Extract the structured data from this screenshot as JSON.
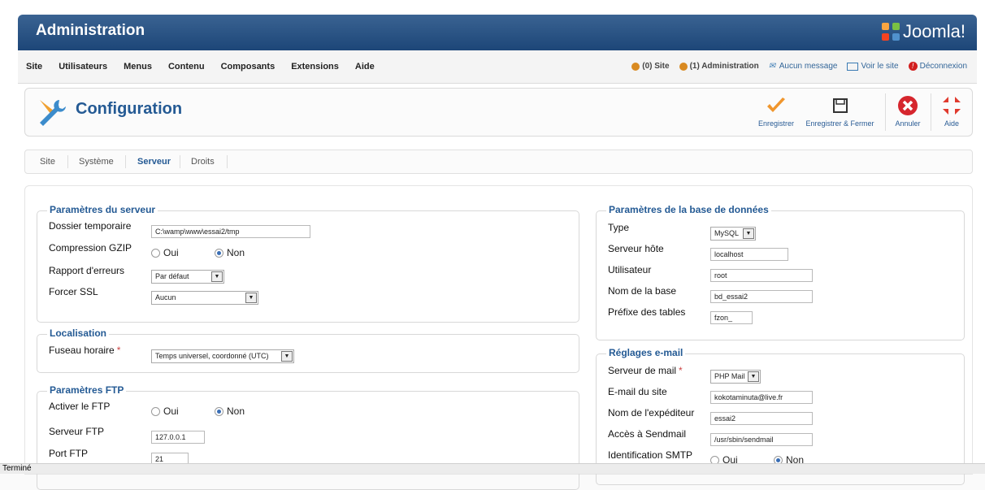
{
  "header": {
    "title": "Administration",
    "logo": "Joomla!"
  },
  "menu": [
    "Site",
    "Utilisateurs",
    "Menus",
    "Contenu",
    "Composants",
    "Extensions",
    "Aide"
  ],
  "status": {
    "site": "(0) Site",
    "admin": "(1) Administration",
    "messages": "Aucun message",
    "view_site": "Voir le site",
    "logout": "Déconnexion"
  },
  "toolbar": {
    "title": "Configuration",
    "save": "Enregistrer",
    "save_close": "Enregistrer & Fermer",
    "cancel": "Annuler",
    "help": "Aide"
  },
  "tabs": [
    "Site",
    "Système",
    "Serveur",
    "Droits"
  ],
  "server": {
    "legend": "Paramètres du serveur",
    "tmp_label": "Dossier temporaire",
    "tmp_value": "C:\\wamp\\www\\essai2/tmp",
    "gzip_label": "Compression GZIP",
    "gzip_yes": "Oui",
    "gzip_no": "Non",
    "errors_label": "Rapport d'erreurs",
    "errors_value": "Par défaut",
    "ssl_label": "Forcer SSL",
    "ssl_value": "Aucun"
  },
  "locale": {
    "legend": "Localisation",
    "tz_label": "Fuseau horaire",
    "tz_value": "Temps universel, coordonné (UTC)"
  },
  "ftp": {
    "legend": "Paramètres FTP",
    "enable_label": "Activer le FTP",
    "yes": "Oui",
    "no": "Non",
    "server_label": "Serveur FTP",
    "server_value": "127.0.0.1",
    "port_label": "Port FTP",
    "port_value": "21"
  },
  "database": {
    "legend": "Paramètres de la base de données",
    "type_label": "Type",
    "type_value": "MySQL",
    "host_label": "Serveur hôte",
    "host_value": "localhost",
    "user_label": "Utilisateur",
    "user_value": "root",
    "name_label": "Nom de la base",
    "name_value": "bd_essai2",
    "prefix_label": "Préfixe des tables",
    "prefix_value": "fzon_"
  },
  "mail": {
    "legend": "Réglages e-mail",
    "mailer_label": "Serveur de mail",
    "mailer_value": "PHP Mail",
    "from_label": "E-mail du site",
    "from_value": "kokotaminuta@live.fr",
    "sender_label": "Nom de l'expéditeur",
    "sender_value": "essai2",
    "sendmail_label": "Accès à Sendmail",
    "sendmail_value": "/usr/sbin/sendmail",
    "smtp_auth_label": "Identification SMTP",
    "yes": "Oui",
    "no": "Non"
  },
  "statusbar": "Terminé"
}
